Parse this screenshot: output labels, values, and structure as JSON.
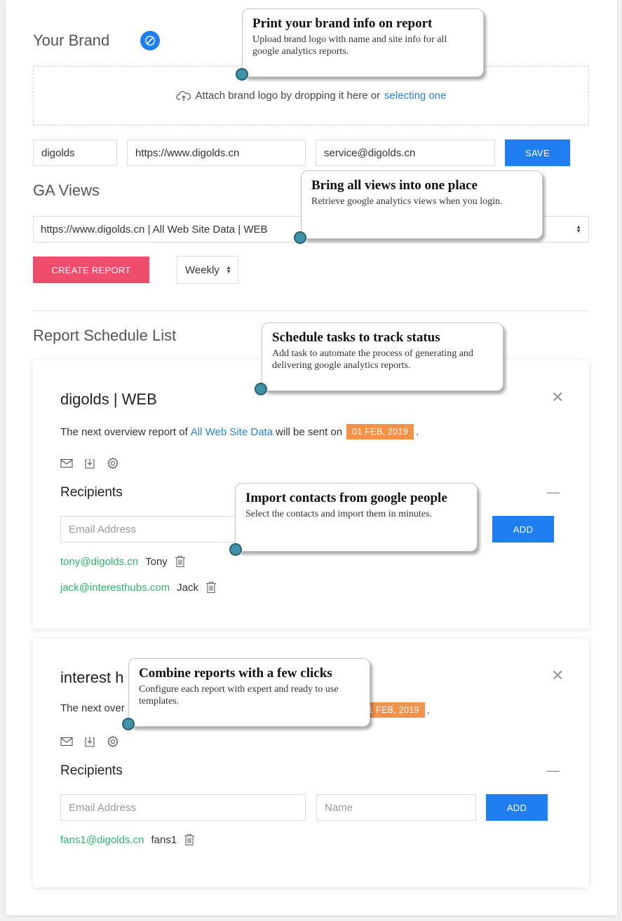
{
  "brand": {
    "title": "Your Brand",
    "edit_icon": "pencil-icon",
    "dropzone_text": "Attach brand logo by dropping it here or",
    "dropzone_link": "selecting one",
    "name_value": "digolds",
    "site_value": "https://www.digolds.cn",
    "email_value": "service@digolds.cn",
    "save_label": "SAVE"
  },
  "views": {
    "title": "GA Views",
    "selected_view": "https://www.digolds.cn | All Web Site Data | WEB",
    "create_label": "CREATE REPORT",
    "frequency": "Weekly"
  },
  "schedule": {
    "title": "Report Schedule List",
    "cards": [
      {
        "title": "digolds | WEB",
        "sentence_before": "The next overview report of",
        "view_link": "All Web Site Data",
        "sentence_mid": "will be sent on",
        "date": "01 FEB, 2019",
        "recipients_title": "Recipients",
        "email_placeholder": "Email Address",
        "add_label": "ADD",
        "recipients": [
          {
            "email": "tony@digolds.cn",
            "name": "Tony"
          },
          {
            "email": "jack@interesthubs.com",
            "name": "Jack"
          }
        ]
      },
      {
        "title": "interest h",
        "sentence_before": "The next over",
        "date": "1 FEB, 2019",
        "recipients_title": "Recipients",
        "email_placeholder": "Email Address",
        "name_placeholder": "Name",
        "add_label": "ADD",
        "recipients": [
          {
            "email": "fans1@digolds.cn",
            "name": "fans1"
          }
        ]
      }
    ]
  },
  "tooltips": [
    {
      "title": "Print your brand info on report",
      "desc": "Upload brand logo with name and site info for all google analytics reports."
    },
    {
      "title": "Bring all views into one place",
      "desc": "Retrieve google analytics views when you login."
    },
    {
      "title": "Schedule tasks to track status",
      "desc": "Add task to automate the process of generating and delivering google analytics reports."
    },
    {
      "title": "Import contacts from google people",
      "desc": "Select the contacts and import them in minutes."
    },
    {
      "title": "Combine reports with a few clicks",
      "desc": "Configure each report with expert and ready to use templates."
    }
  ],
  "colors": {
    "primary": "#1f7ef0",
    "create": "#ef4d6c",
    "date_badge": "#f5924a",
    "recipient_email": "#2db46d",
    "link": "#2a7fd6",
    "tooltip_dot": "#3f93a8"
  }
}
